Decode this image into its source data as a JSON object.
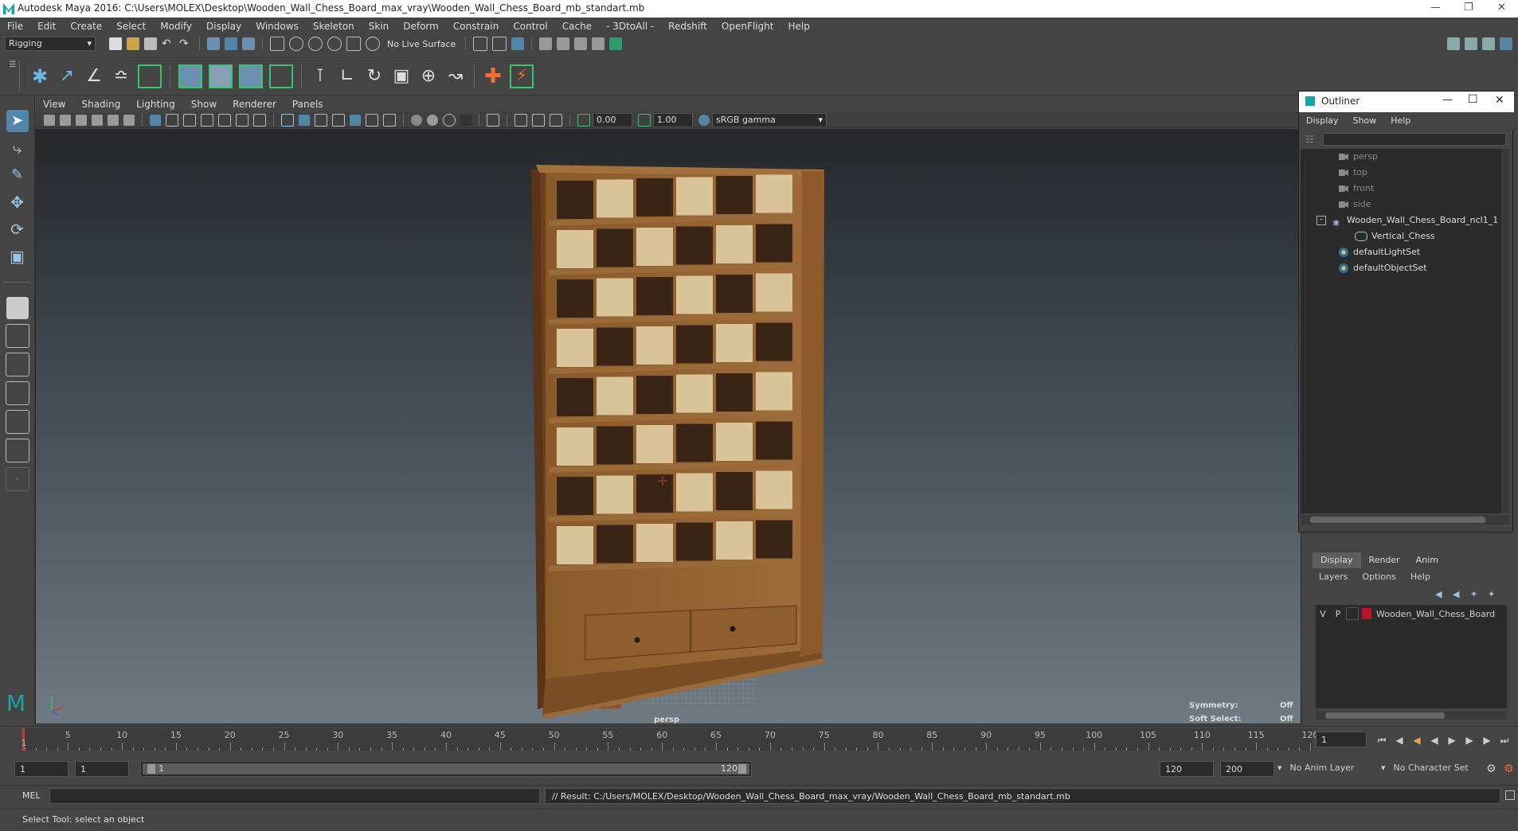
{
  "app": {
    "title": "Autodesk Maya 2016: C:\\Users\\MOLEX\\Desktop\\Wooden_Wall_Chess_Board_max_vray\\Wooden_Wall_Chess_Board_mb_standart.mb"
  },
  "menubar": [
    "File",
    "Edit",
    "Create",
    "Select",
    "Modify",
    "Display",
    "Windows",
    "Skeleton",
    "Skin",
    "Deform",
    "Constrain",
    "Control",
    "Cache",
    "- 3DtoAll -",
    "Redshift",
    "OpenFlight",
    "Help"
  ],
  "statusline": {
    "menuset": "Rigging",
    "live_surface": "No Live Surface"
  },
  "viewport": {
    "menus": [
      "View",
      "Shading",
      "Lighting",
      "Show",
      "Renderer",
      "Panels"
    ],
    "exposure": "0.00",
    "gamma": "1.00",
    "colorspace": "sRGB gamma",
    "camera_label": "persp",
    "hud": {
      "symmetry_label": "Symmetry:",
      "symmetry_value": "Off",
      "soft_select_label": "Soft Select:",
      "soft_select_value": "Off"
    }
  },
  "outliner": {
    "title": "Outliner",
    "menus": [
      "Display",
      "Show",
      "Help"
    ],
    "items": [
      {
        "label": "persp",
        "type": "camera"
      },
      {
        "label": "top",
        "type": "camera"
      },
      {
        "label": "front",
        "type": "camera"
      },
      {
        "label": "side",
        "type": "camera"
      },
      {
        "label": "Wooden_Wall_Chess_Board_ncl1_1",
        "type": "group"
      },
      {
        "label": "Vertical_Chess",
        "type": "mesh"
      },
      {
        "label": "defaultLightSet",
        "type": "set"
      },
      {
        "label": "defaultObjectSet",
        "type": "set"
      }
    ]
  },
  "layer_editor": {
    "tabs": [
      "Display",
      "Render",
      "Anim"
    ],
    "active_tab": "Display",
    "menus": [
      "Layers",
      "Options",
      "Help"
    ],
    "layer": {
      "v": "V",
      "p": "P",
      "name": "Wooden_Wall_Chess_Board",
      "color": "#c0102a"
    }
  },
  "timeline": {
    "ticks": [
      5,
      10,
      15,
      20,
      25,
      30,
      35,
      40,
      45,
      50,
      55,
      60,
      65,
      70,
      75,
      80,
      85,
      90,
      95,
      100,
      105,
      110,
      115,
      120
    ],
    "current_frame": "1",
    "first_tick_label": "1"
  },
  "range": {
    "start": "1",
    "inner_start": "1",
    "slider_start": "1",
    "slider_end": "120",
    "end": "120",
    "max": "200",
    "anim_layer": "No Anim Layer",
    "character_set": "No Character Set"
  },
  "command": {
    "language": "MEL",
    "result": "// Result: C:/Users/MOLEX/Desktop/Wooden_Wall_Chess_Board_max_vray/Wooden_Wall_Chess_Board_mb_standart.mb"
  },
  "helpline": "Select Tool: select an object",
  "colors": {
    "accent": "#5285a6",
    "wood": "#8a5a2b",
    "dark_square": "#3a2416",
    "light_square": "#d9c49a"
  }
}
